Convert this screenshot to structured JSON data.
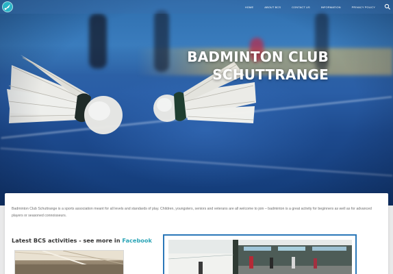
{
  "nav": {
    "logo_icon": "shuttlecock-logo-icon",
    "items": [
      {
        "label": "HOME"
      },
      {
        "label": "ABOUT BCS"
      },
      {
        "label": "CONTACT US"
      },
      {
        "label": "INFORMATION"
      },
      {
        "label": "PRIVACY POLICY"
      }
    ],
    "search_icon": "search-icon"
  },
  "hero": {
    "title_line1": "BADMINTON CLUB",
    "title_line2": "SCHUTTRANGE"
  },
  "content": {
    "intro": "Badminton Club Schuttrange is a sports association meant for all levels and standards of play. Children, youngsters, seniors and veterans are all welcome to join – badminton is a great activity for beginners as well as for advanced players or seasoned connoisseurs.",
    "activities_heading": "Latest BCS activities - see more in ",
    "activities_link": "Facebook"
  },
  "colors": {
    "accent": "#2aa4b6",
    "frame": "#2a77b8"
  }
}
